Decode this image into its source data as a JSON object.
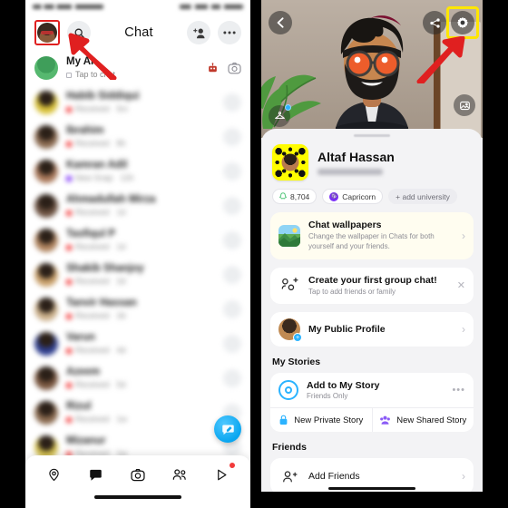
{
  "left_panel": {
    "header": {
      "avatar_name": "profile-avatar",
      "search_label": "Search",
      "title": "Chat",
      "add_friend_label": "Add Friend",
      "more_label": "More options"
    },
    "myai": {
      "name": "My AI",
      "subtitle": "Tap to chat",
      "robot_icon": "robot-icon",
      "camera_icon": "camera-icon"
    },
    "chat_rows": [
      {
        "name": "Habib Siddiqui",
        "status": "Received",
        "time": "5m",
        "dot": "#f23b3b",
        "av": "#d9c23a"
      },
      {
        "name": "Ibrahim",
        "status": "Received",
        "time": "8h",
        "dot": "#f23b3b",
        "av": "#8a6a50"
      },
      {
        "name": "Kamran Adil",
        "status": "New Snap",
        "time": "12h",
        "dot": "#7b2ff7",
        "av": "#a9785a"
      },
      {
        "name": "Ahmadullah Mirza",
        "status": "Received",
        "time": "1d",
        "dot": "#f23b3b",
        "av": "#6b5140"
      },
      {
        "name": "Tasfiqul P",
        "status": "Received",
        "time": "1d",
        "dot": "#f23b3b",
        "av": "#b0845f"
      },
      {
        "name": "Shakib Shanjoy",
        "status": "Received",
        "time": "2d",
        "dot": "#f23b3b",
        "av": "#c9a06a"
      },
      {
        "name": "Tanvir Hassan",
        "status": "Received",
        "time": "3d",
        "dot": "#f23b3b",
        "av": "#cbb08a"
      },
      {
        "name": "Varun",
        "status": "Received",
        "time": "4d",
        "dot": "#f23b3b",
        "av": "#2f3f8f"
      },
      {
        "name": "Azeem",
        "status": "Received",
        "time": "5d",
        "dot": "#f23b3b",
        "av": "#7a5740"
      },
      {
        "name": "Rizul",
        "status": "Received",
        "time": "1w",
        "dot": "#f23b3b",
        "av": "#8b6b50"
      },
      {
        "name": "Mizanur",
        "status": "Received",
        "time": "1w",
        "dot": "#f23b3b",
        "av": "#d6c251"
      }
    ],
    "new_chat_fab": "New Chat",
    "bottom_nav": [
      {
        "name": "Map",
        "icon": "map-pin-icon",
        "active": false,
        "badge": false
      },
      {
        "name": "Chat",
        "icon": "chat-bubble-icon",
        "active": true,
        "badge": false
      },
      {
        "name": "Camera",
        "icon": "camera-icon",
        "active": false,
        "badge": false
      },
      {
        "name": "Friends",
        "icon": "friends-icon",
        "active": false,
        "badge": false
      },
      {
        "name": "Spotlight",
        "icon": "play-icon",
        "active": false,
        "badge": true
      }
    ]
  },
  "right_panel": {
    "hero": {
      "back_label": "Back",
      "share_label": "Share",
      "settings_label": "Settings",
      "outfit_label": "Change outfit",
      "background_label": "Change background"
    },
    "profile": {
      "name": "Altaf Hassan",
      "username_hidden": true,
      "snapscore_icon": "ghost-icon",
      "snapscore": "8,704",
      "zodiac": "Capricorn",
      "add_university": "+ add university"
    },
    "cards": [
      {
        "id": "chat-wallpapers",
        "title": "Chat wallpapers",
        "subtitle": "Change the wallpaper in Chats for both yourself and your friends.",
        "icon": "wallpaper-icon",
        "action": "chevron-right-icon"
      },
      {
        "id": "create-group-chat",
        "title": "Create your first group chat!",
        "subtitle": "Tap to add friends or family",
        "icon": "add-group-icon",
        "action": "close-icon"
      },
      {
        "id": "my-public-profile",
        "title": "My Public Profile",
        "subtitle": "",
        "icon": "public-profile-icon",
        "action": "chevron-right-icon"
      }
    ],
    "my_stories": {
      "heading": "My Stories",
      "add_story": {
        "title": "Add to My Story",
        "subtitle": "Friends Only",
        "icon": "camera-ring-icon",
        "more": "•••"
      },
      "new_private_story": {
        "label": "New Private Story",
        "icon": "lock-icon",
        "color": "#2bb3ff"
      },
      "new_shared_story": {
        "label": "New Shared Story",
        "icon": "group-icon",
        "color": "#8b5cf6"
      }
    },
    "friends": {
      "heading": "Friends",
      "add_friends": {
        "label": "Add Friends",
        "icon": "add-person-icon",
        "action": "chevron-right-icon"
      }
    }
  },
  "annotations": {
    "avatar_highlight_color": "#e02020",
    "gear_highlight_color": "#ffe600",
    "arrow_color": "#e02020"
  }
}
